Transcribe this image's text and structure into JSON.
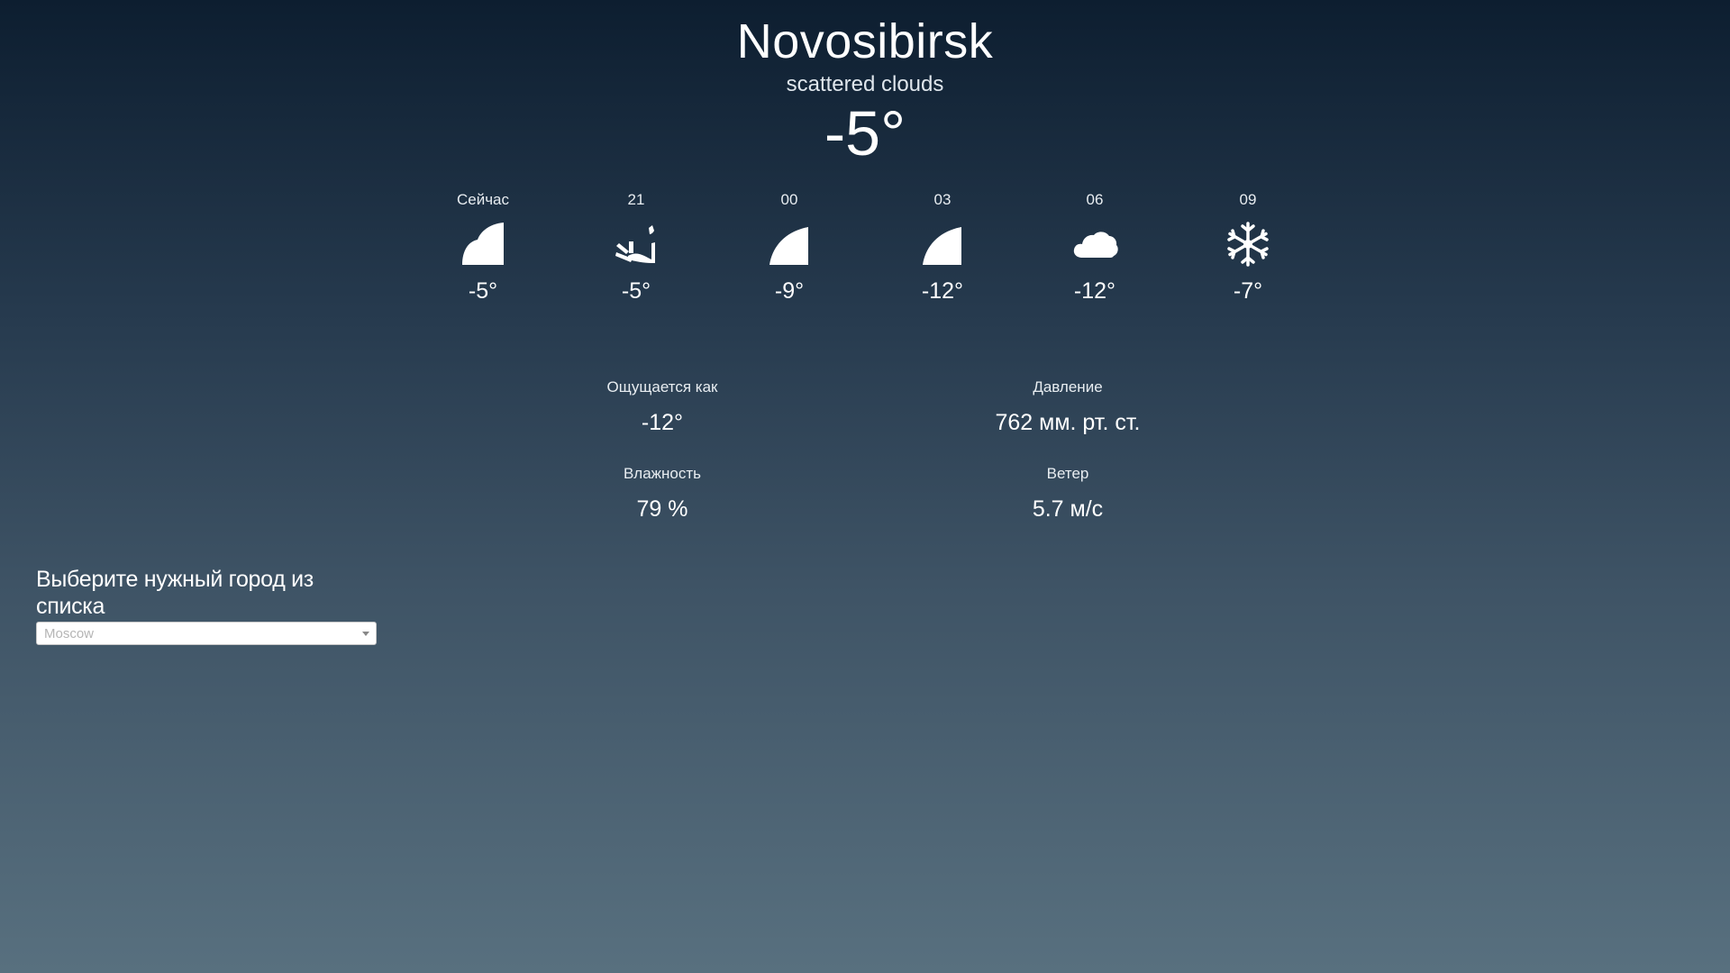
{
  "current": {
    "city": "Novosibirsk",
    "description": "scattered clouds",
    "temperature": "-5°"
  },
  "forecast": [
    {
      "time": "Сейчас",
      "temp": "-5°",
      "icon": "night-partly-icon"
    },
    {
      "time": "21",
      "temp": "-5°",
      "icon": "night-windy-icon"
    },
    {
      "time": "00",
      "temp": "-9°",
      "icon": "night-moon-icon"
    },
    {
      "time": "03",
      "temp": "-12°",
      "icon": "night-moon-icon"
    },
    {
      "time": "06",
      "temp": "-12°",
      "icon": "cloud-icon"
    },
    {
      "time": "09",
      "temp": "-7°",
      "icon": "snowflake-icon"
    }
  ],
  "details": {
    "feels_like": {
      "label": "Ощущается как",
      "value": "-12°"
    },
    "pressure": {
      "label": "Давление",
      "value": "762 мм. рт. ст."
    },
    "humidity": {
      "label": "Влажность",
      "value": "79 %"
    },
    "wind": {
      "label": "Ветер",
      "value": "5.7 м/с"
    }
  },
  "city_select": {
    "label": "Выберите нужный город из списка",
    "selected": "Moscow"
  },
  "colors": {
    "background_top": "#0d1e30",
    "background_bottom": "#58707f",
    "text": "#ffffff"
  }
}
